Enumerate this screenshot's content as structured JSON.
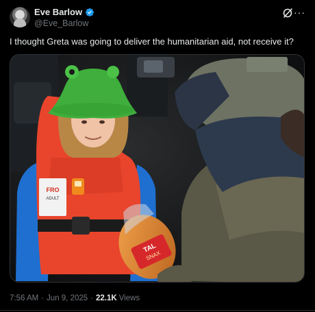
{
  "author": {
    "display_name": "Eve Barlow",
    "handle": "@Eve_Barlow",
    "verified": true
  },
  "post": {
    "text": "I thought Greta was going to deliver the humanitarian aid, not receive it?"
  },
  "media": {
    "vest_label_line1": "FRO",
    "vest_label_line2": "ADULT",
    "package_label_line1": "TAL",
    "package_label_line2": "SNAX"
  },
  "meta": {
    "time": "7:56 AM",
    "separator": "·",
    "date": "Jun 9, 2025",
    "views_count": "22.1K",
    "views_label": "Views"
  },
  "colors": {
    "verified_badge": "#1d9bf0",
    "text_secondary": "#71767b",
    "background": "#000000"
  },
  "icons": [
    "verified-badge-icon",
    "grok-icon",
    "more-options-icon"
  ]
}
